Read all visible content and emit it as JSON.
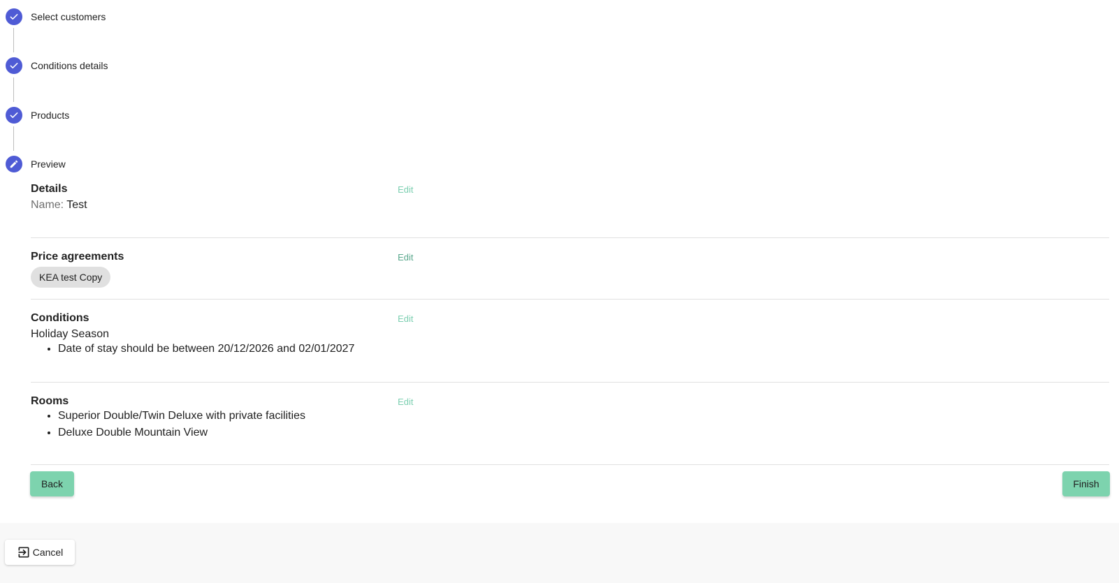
{
  "stepper": {
    "steps": [
      {
        "label": "Select customers",
        "status": "completed",
        "icon": "check-icon"
      },
      {
        "label": "Conditions details",
        "status": "completed",
        "icon": "check-icon"
      },
      {
        "label": "Products",
        "status": "completed",
        "icon": "check-icon"
      },
      {
        "label": "Preview",
        "status": "active",
        "icon": "pencil-icon"
      }
    ]
  },
  "preview": {
    "details": {
      "title": "Details",
      "edit_label": "Edit",
      "name_key": "Name:",
      "name_value": "Test"
    },
    "price_agreements": {
      "title": "Price agreements",
      "edit_label": "Edit",
      "chips": [
        "KEA test Copy"
      ]
    },
    "conditions": {
      "title": "Conditions",
      "edit_label": "Edit",
      "name": "Holiday Season",
      "items": [
        "Date of stay should be between 20/12/2026 and 02/01/2027"
      ]
    },
    "rooms": {
      "title": "Rooms",
      "edit_label": "Edit",
      "items": [
        "Superior Double/Twin Deluxe with private facilities",
        "Deluxe Double Mountain View"
      ]
    }
  },
  "actions": {
    "back_label": "Back",
    "finish_label": "Finish",
    "cancel_label": "Cancel",
    "cancel_icon": "exit-icon"
  },
  "colors": {
    "step_accent": "#4f5bd5",
    "button_green": "#7dd3ae",
    "edit_link": "#7ccfb1",
    "footer_bg": "#f8f8f8"
  }
}
